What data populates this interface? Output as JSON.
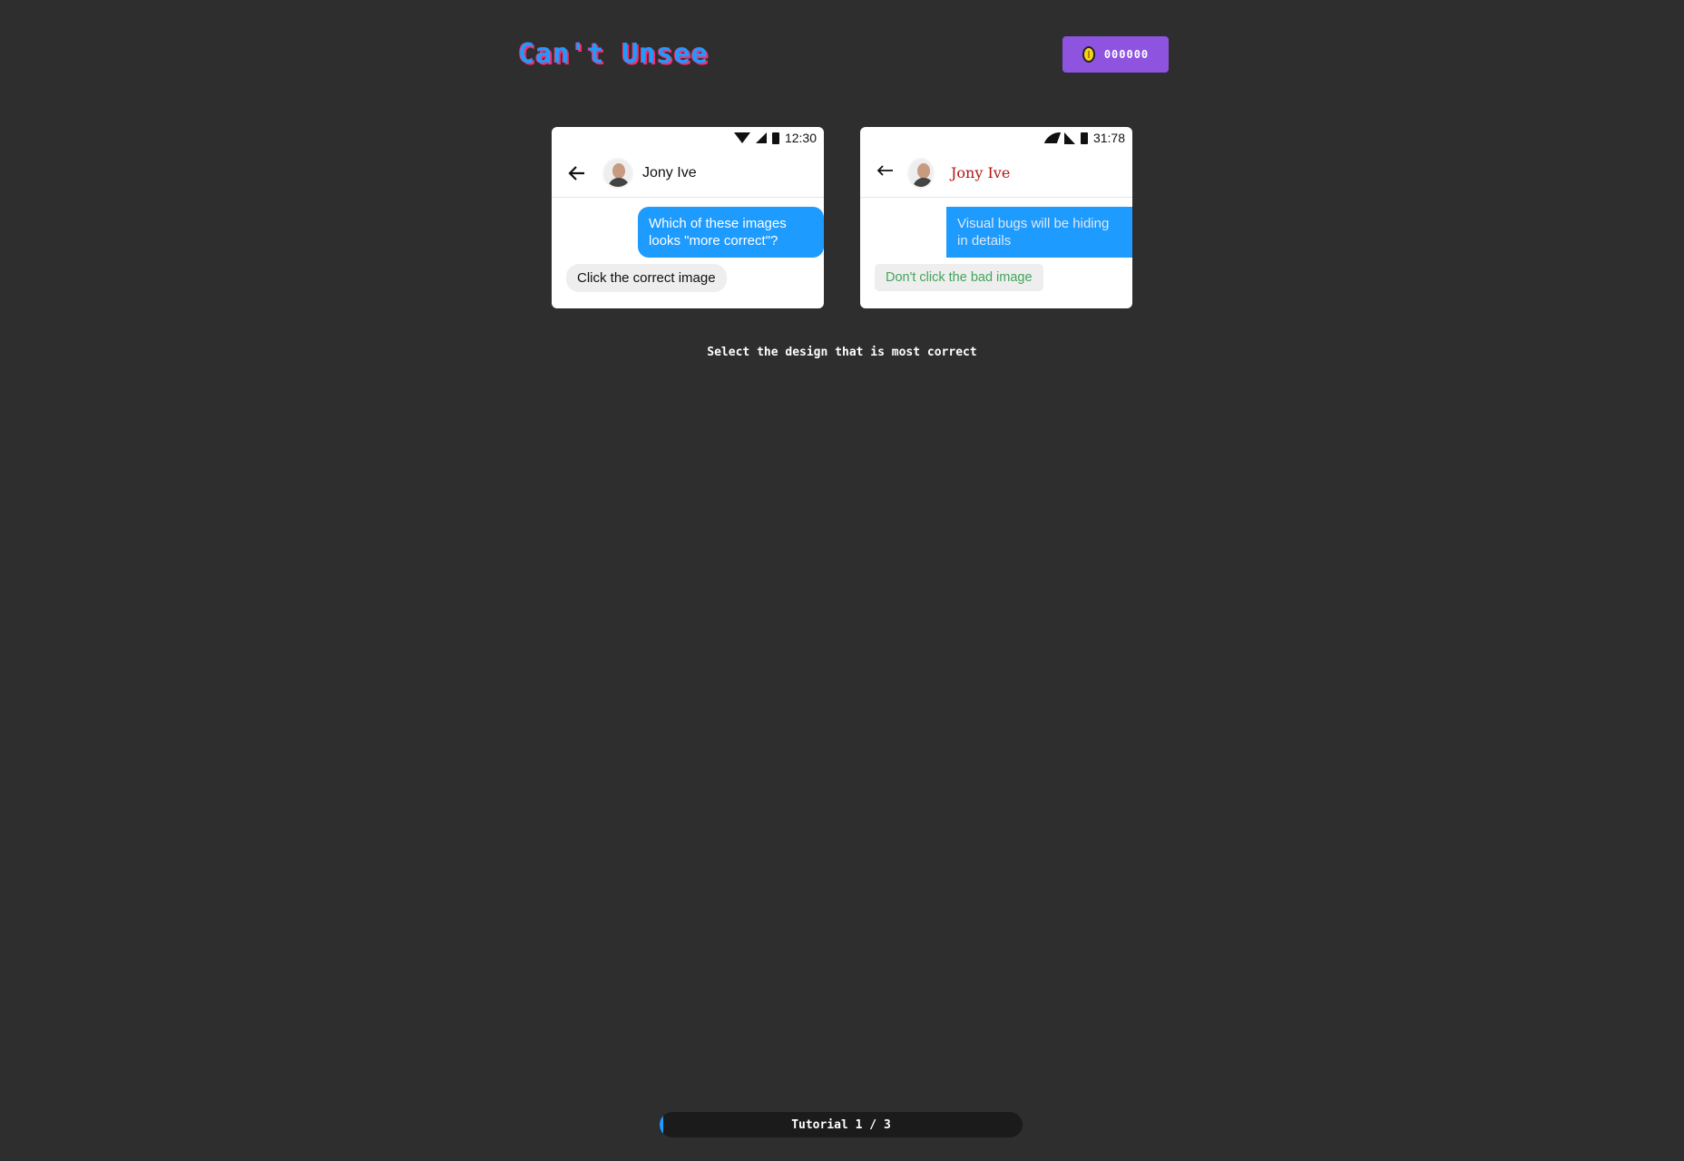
{
  "app": {
    "title": "Can't Unsee"
  },
  "coins": {
    "icon": "coin-icon",
    "value": "000000"
  },
  "options": [
    {
      "status_time": "12:30",
      "contact_name": "Jony Ive",
      "outgoing_message": "Which of these images looks \"more correct\"?",
      "incoming_message": "Click the correct image"
    },
    {
      "status_time": "31:78",
      "contact_name": "Jony Ive",
      "outgoing_message": "Visual bugs will be hiding in details",
      "incoming_message": "Don't click the bad image"
    }
  ],
  "instruction": "Select the design that is most correct",
  "progress": {
    "label": "Tutorial 1 / 3",
    "fraction": 0.01
  },
  "colors": {
    "accent": "#1e9bff",
    "coins_bg": "#8e54e0",
    "background": "#2e2e2e"
  }
}
